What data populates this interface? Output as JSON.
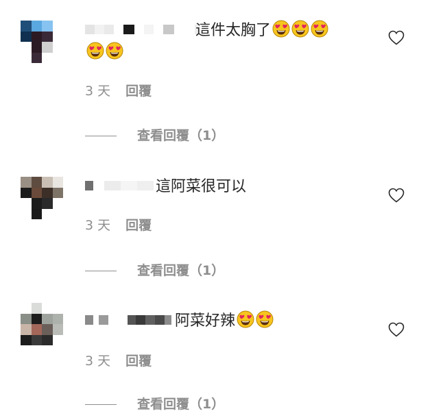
{
  "comments": [
    {
      "text": "這件太胸了",
      "emoji_inline": 3,
      "emoji_wrap": 2,
      "time": "3 天",
      "reply_label": "回覆",
      "view_replies": "查看回覆（1）",
      "avatar_colors": [
        "#1f4e79",
        "#5aa8e0",
        "#87c3f0",
        "#ffffff",
        "#0f3050",
        "#2b1a23",
        "#3a2a38",
        "#ffffff",
        "#ffffff",
        "#2b1a23",
        "#cfcfcf",
        "#ffffff",
        "#ffffff",
        "#3a2a38",
        "#ffffff",
        "#ffffff"
      ]
    },
    {
      "text": "這阿菜很可以",
      "time": "3 天",
      "reply_label": "回覆",
      "view_replies": "查看回覆（1）",
      "avatar_colors": [
        "#9a8f84",
        "#5f4c40",
        "#c9bfb4",
        "#e9e6e2",
        "#1b1b1b",
        "#6a4a3a",
        "#3b2f28",
        "#7d7366",
        "#ffffff",
        "#1c1c1c",
        "#2a2a2a",
        "#ffffff",
        "#ffffff",
        "#1a1a1a",
        "#ffffff",
        "#ffffff"
      ]
    },
    {
      "text": "阿菜好辣",
      "emoji_inline": 2,
      "time": "3 天",
      "reply_label": "回覆",
      "view_replies": "查看回覆（1）",
      "avatar_colors": [
        "#ffffff",
        "#d9dcd8",
        "#ffffff",
        "#ffffff",
        "#8a8f88",
        "#1d1d1d",
        "#9fa39d",
        "#aeb2ac",
        "#c9b5a8",
        "#a4675a",
        "#6b5f5a",
        "#b9bcb7",
        "#1c1c1c",
        "#3a3a3a",
        "#2b2b2b",
        "#ffffff"
      ]
    }
  ],
  "icons": {
    "like": "heart-outline-icon",
    "emoji": "heart-eyes-emoji-icon"
  }
}
